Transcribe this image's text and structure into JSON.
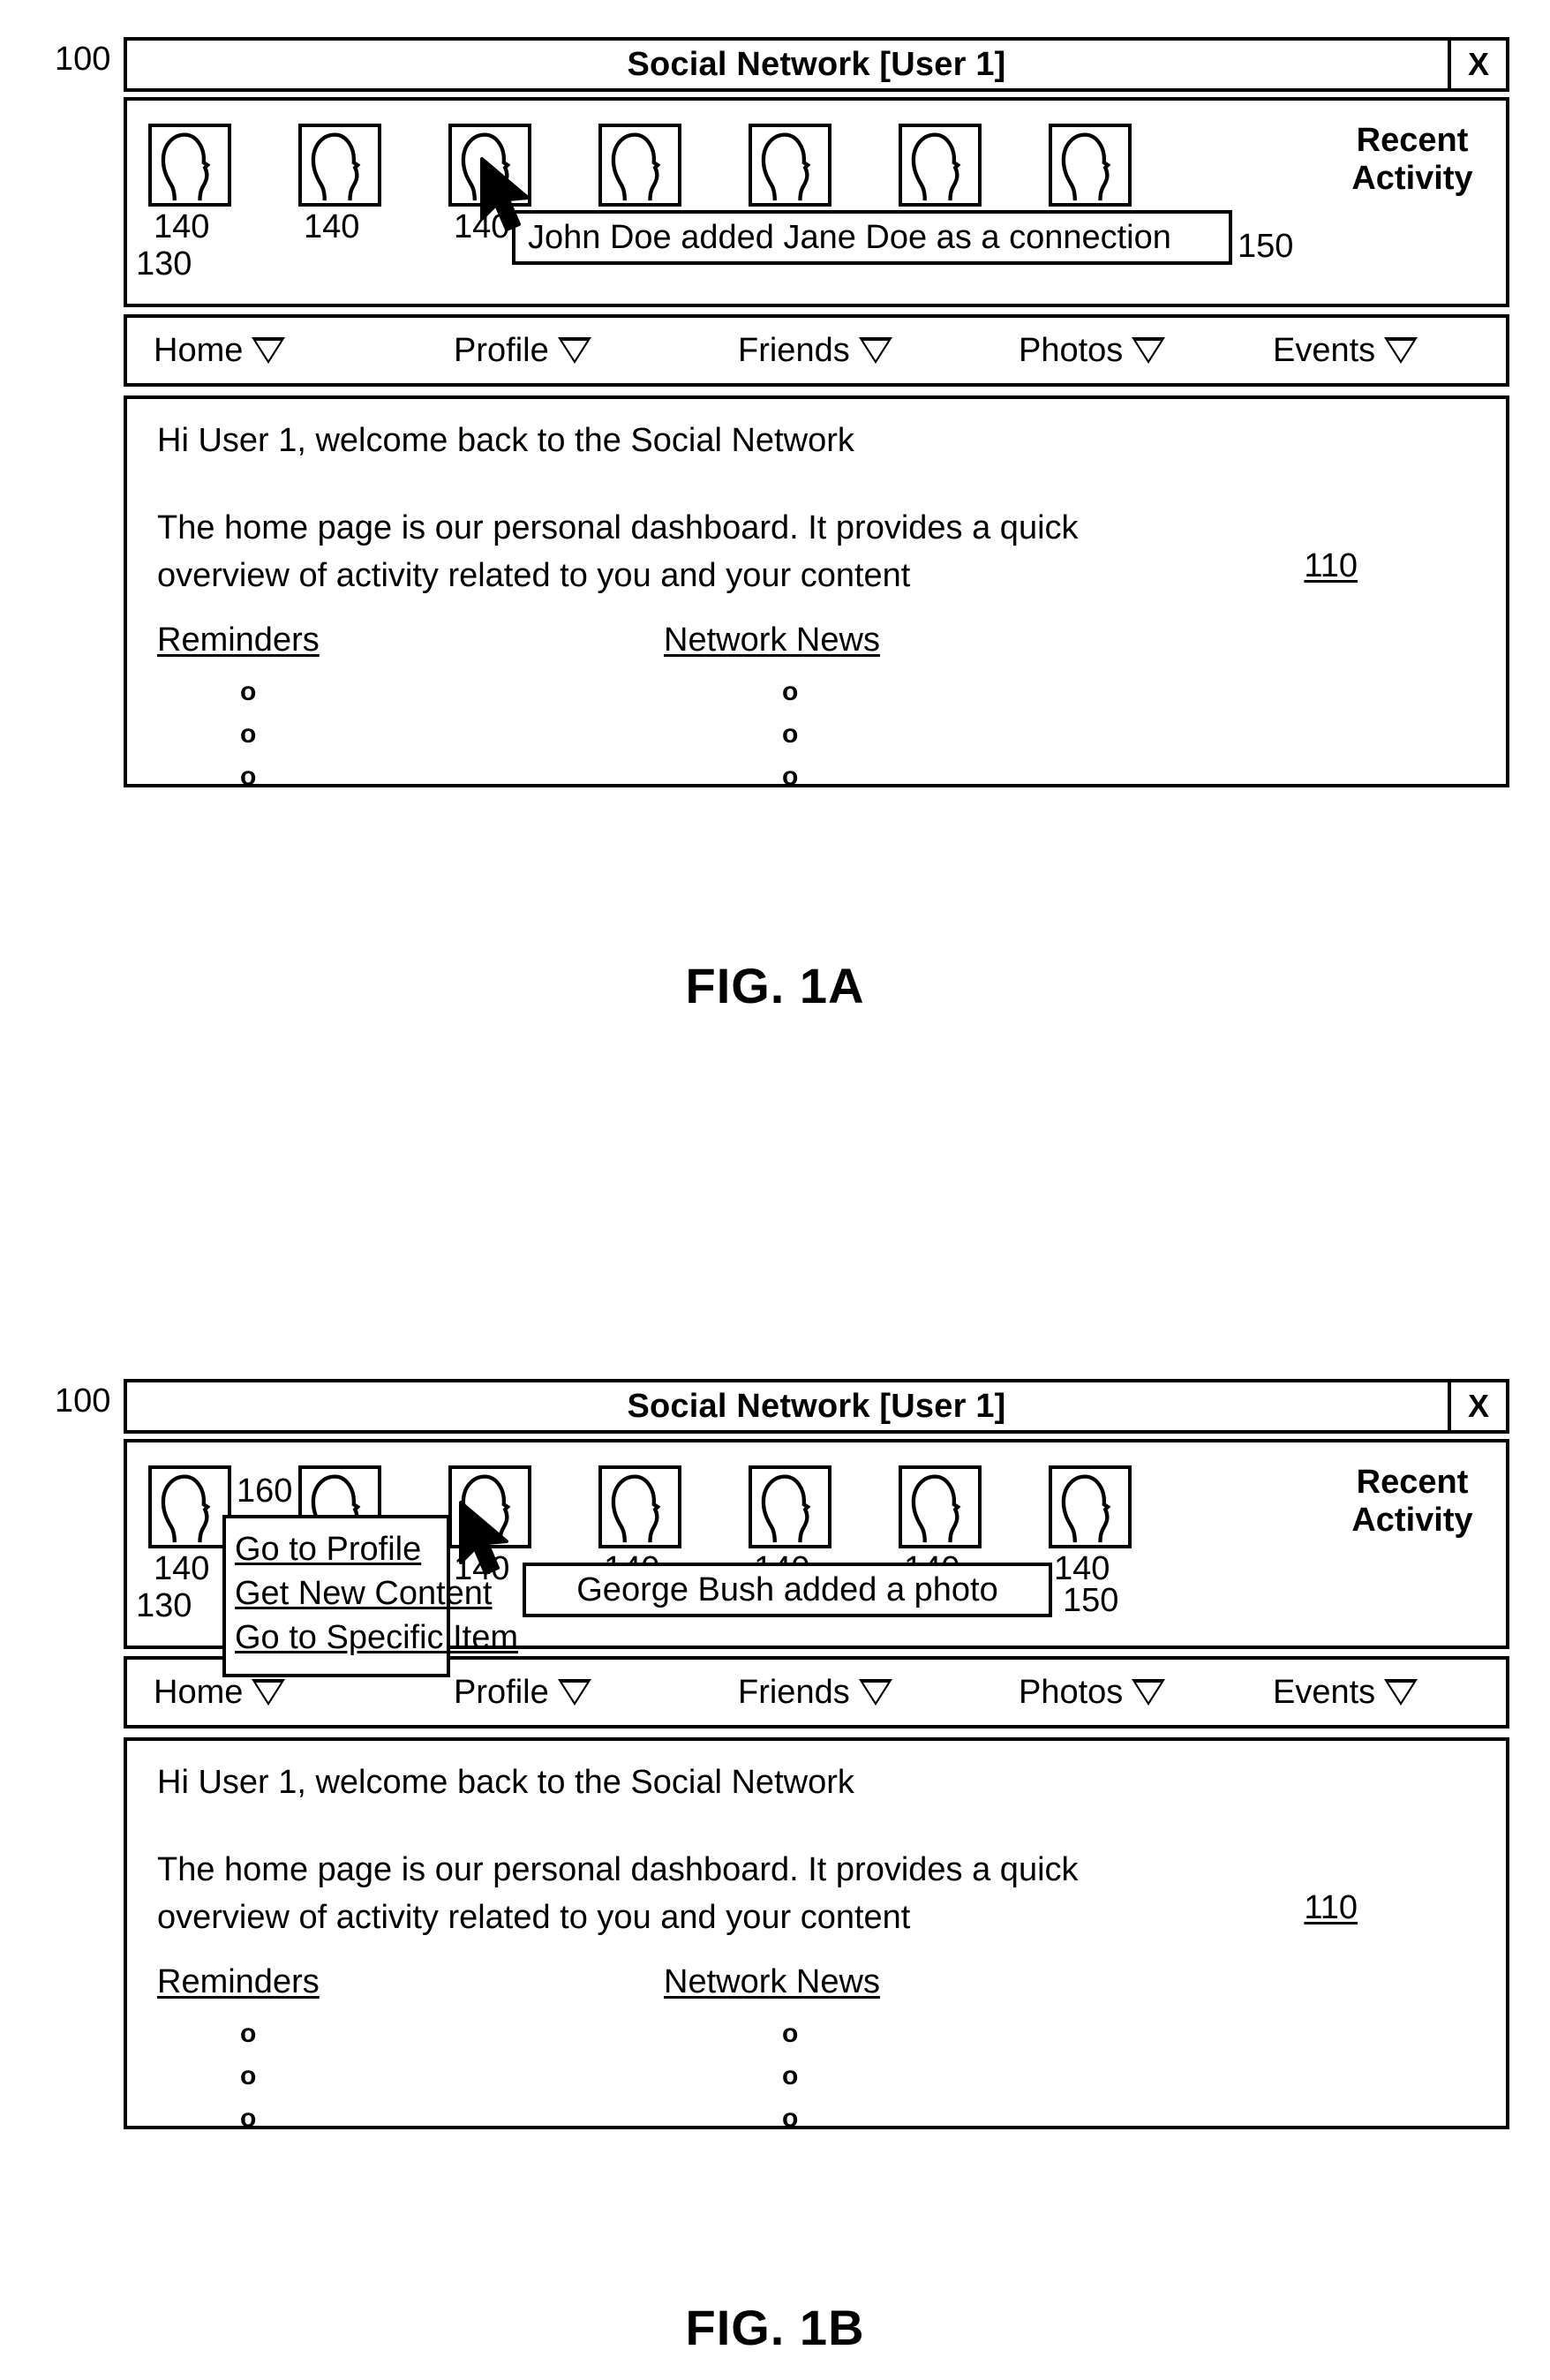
{
  "figures": [
    {
      "id": "fig-1a",
      "caption": "FIG. 1A",
      "window_ref": "100",
      "strip_ref": "130",
      "strip_right_ref": "150",
      "content_ref": "110",
      "title": "Social Network [User 1]",
      "close_label": "X",
      "recent_activity_line1": "Recent",
      "recent_activity_line2": "Activity",
      "avatar_ref": "140",
      "avatar_count": 7,
      "tooltip": "John Doe added Jane Doe as a connection",
      "context_menu": null,
      "context_menu_ref": null,
      "nav": [
        {
          "label": "Home"
        },
        {
          "label": "Profile"
        },
        {
          "label": "Friends"
        },
        {
          "label": "Photos"
        },
        {
          "label": "Events"
        }
      ],
      "content": {
        "greeting": "Hi User 1, welcome back to the Social Network",
        "blurb": "The home page is our personal dashboard.  It provides a quick overview of activity related to you and your content",
        "columns": [
          {
            "heading": "Reminders",
            "bullets": [
              "o",
              "o",
              "o"
            ]
          },
          {
            "heading": "Network News",
            "bullets": [
              "o",
              "o",
              "o"
            ]
          }
        ]
      }
    },
    {
      "id": "fig-1b",
      "caption": "FIG. 1B",
      "window_ref": "100",
      "strip_ref": "130",
      "strip_right_ref": "150",
      "content_ref": "110",
      "title": "Social Network [User 1]",
      "close_label": "X",
      "recent_activity_line1": "Recent",
      "recent_activity_line2": "Activity",
      "avatar_ref": "140",
      "avatar_count": 7,
      "tooltip": "George Bush added a photo",
      "context_menu_ref": "160",
      "context_menu": [
        {
          "label": "Go to Profile"
        },
        {
          "label": "Get New Content"
        },
        {
          "label": "Go to Specific Item"
        }
      ],
      "nav": [
        {
          "label": "Home"
        },
        {
          "label": "Profile"
        },
        {
          "label": "Friends"
        },
        {
          "label": "Photos"
        },
        {
          "label": "Events"
        }
      ],
      "content": {
        "greeting": "Hi User 1, welcome back to the Social Network",
        "blurb": "The home page is our personal dashboard.  It provides a quick overview of activity related to you and your content",
        "columns": [
          {
            "heading": "Reminders",
            "bullets": [
              "o",
              "o",
              "o"
            ]
          },
          {
            "heading": "Network News",
            "bullets": [
              "o",
              "o",
              "o"
            ]
          }
        ]
      }
    }
  ]
}
